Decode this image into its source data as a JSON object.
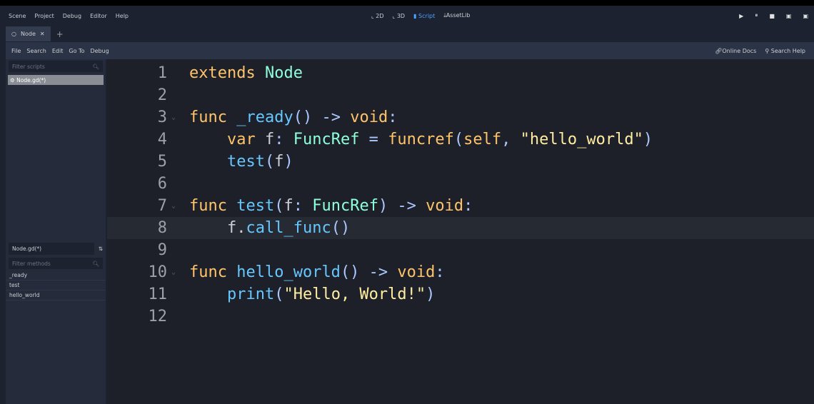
{
  "menu": [
    "Scene",
    "Project",
    "Debug",
    "Editor",
    "Help"
  ],
  "workspaces": [
    {
      "label": "2D",
      "icon": "2d-icon"
    },
    {
      "label": "3D",
      "icon": "3d-icon"
    },
    {
      "label": "Script",
      "icon": "script-icon",
      "active": true
    },
    {
      "label": "AssetLib",
      "icon": "assetlib-icon"
    }
  ],
  "scene_tab": "Node",
  "script_menu": [
    "File",
    "Search",
    "Edit",
    "Go To",
    "Debug"
  ],
  "online_docs": "Online Docs",
  "search_help": "Search Help",
  "filter_scripts": "Filter scripts",
  "scripts": [
    "Node.gd(*)"
  ],
  "current_script": "Node.gd(*)",
  "filter_methods": "Filter methods",
  "methods": [
    "_ready",
    "test",
    "hello_world"
  ],
  "current_line": 8,
  "code": [
    [
      [
        "kw",
        "extends "
      ],
      [
        "ty",
        "Node"
      ]
    ],
    [],
    [
      [
        "kw",
        "func "
      ],
      [
        "fn",
        "_ready"
      ],
      [
        "sy",
        "() -> "
      ],
      [
        "kw",
        "void"
      ],
      [
        "sy",
        ":"
      ]
    ],
    [
      [
        "tx",
        "    "
      ],
      [
        "kw",
        "var "
      ],
      [
        "tx",
        "f"
      ],
      [
        "sy",
        ": "
      ],
      [
        "ty",
        "FuncRef"
      ],
      [
        "sy",
        " = "
      ],
      [
        "kw",
        "funcref"
      ],
      [
        "sy",
        "("
      ],
      [
        "kw",
        "self"
      ],
      [
        "sy",
        ", "
      ],
      [
        "st",
        "\"hello_world\""
      ],
      [
        "sy",
        ")"
      ]
    ],
    [
      [
        "tx",
        "    "
      ],
      [
        "call",
        "test"
      ],
      [
        "sy",
        "("
      ],
      [
        "tx",
        "f"
      ],
      [
        "sy",
        ")"
      ]
    ],
    [],
    [
      [
        "kw",
        "func "
      ],
      [
        "fn",
        "test"
      ],
      [
        "sy",
        "("
      ],
      [
        "tx",
        "f"
      ],
      [
        "sy",
        ": "
      ],
      [
        "ty",
        "FuncRef"
      ],
      [
        "sy",
        ") -> "
      ],
      [
        "kw",
        "void"
      ],
      [
        "sy",
        ":"
      ]
    ],
    [
      [
        "tx",
        "    f."
      ],
      [
        "call",
        "call_func"
      ],
      [
        "sy",
        "()"
      ]
    ],
    [],
    [
      [
        "kw",
        "func "
      ],
      [
        "fn",
        "hello_world"
      ],
      [
        "sy",
        "() -> "
      ],
      [
        "kw",
        "void"
      ],
      [
        "sy",
        ":"
      ]
    ],
    [
      [
        "tx",
        "    "
      ],
      [
        "call",
        "print"
      ],
      [
        "sy",
        "("
      ],
      [
        "st",
        "\"Hello, World!\""
      ],
      [
        "sy",
        ")"
      ]
    ],
    []
  ]
}
